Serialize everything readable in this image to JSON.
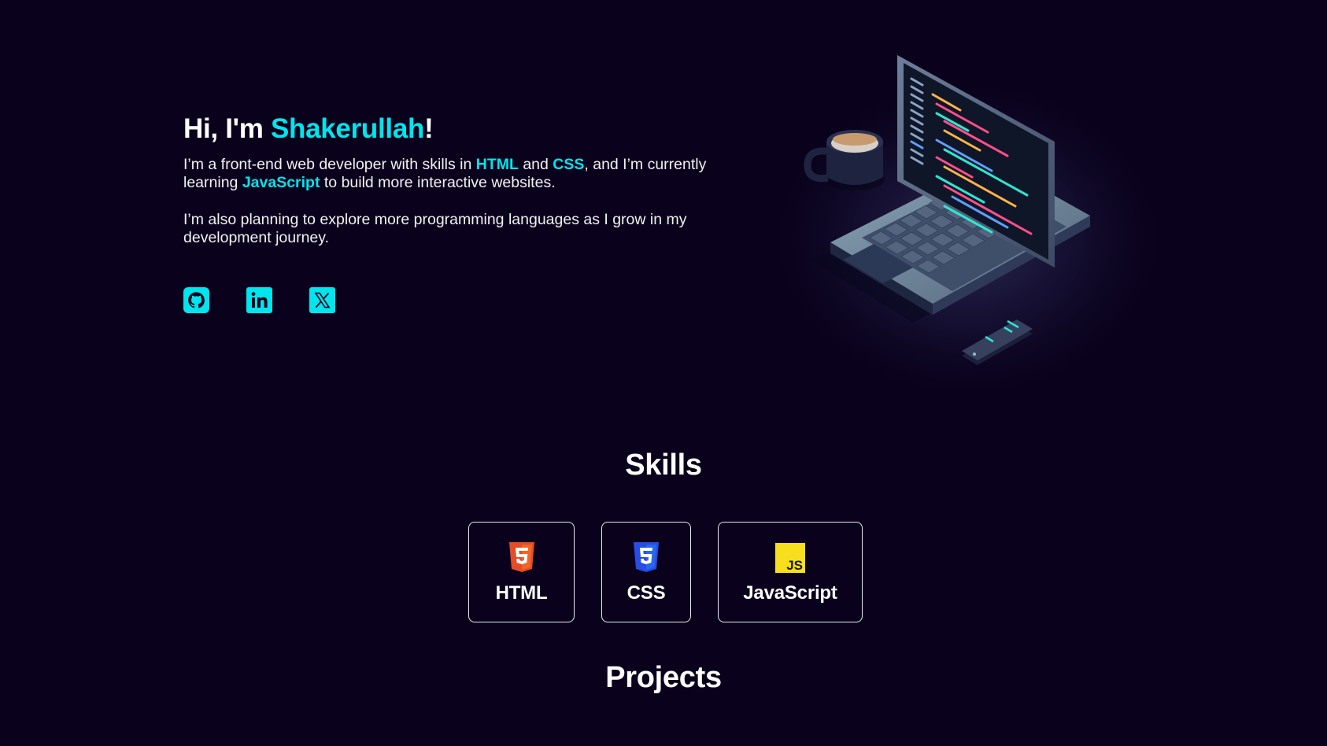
{
  "hero": {
    "greeting_prefix": "Hi, I'm ",
    "name": "Shakerullah",
    "greeting_suffix": "!",
    "para1": {
      "t1": "I’m a front-end web developer with skills in ",
      "skill1": "HTML",
      "t2": " and ",
      "skill2": "CSS",
      "t3": ", and I’m currently learning ",
      "skill3": "JavaScript",
      "t4": " to build more interactive websites."
    },
    "para2": "I’m also planning to explore more programming languages as I grow in my development journey."
  },
  "socials": [
    {
      "icon": "github-icon"
    },
    {
      "icon": "linkedin-icon"
    },
    {
      "icon": "x-twitter-icon"
    }
  ],
  "skills": {
    "title": "Skills",
    "items": [
      {
        "label": "HTML",
        "icon": "html5-icon"
      },
      {
        "label": "CSS",
        "icon": "css3-icon"
      },
      {
        "label": "JavaScript",
        "icon": "javascript-icon"
      }
    ]
  },
  "projects": {
    "title": "Projects"
  },
  "colors": {
    "background": "#0a021c",
    "accent": "#00e5ee",
    "text": "#ffffff",
    "html_orange": "#e44d26",
    "css_blue": "#264de4",
    "js_yellow": "#f7df1e"
  }
}
